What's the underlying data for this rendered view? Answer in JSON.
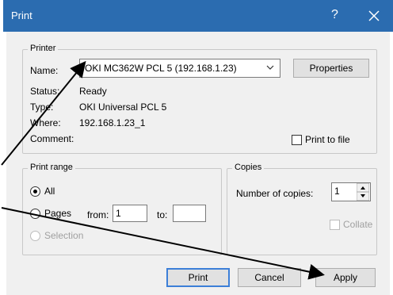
{
  "window": {
    "title": "Print",
    "help_glyph": "?",
    "close_glyph": "×"
  },
  "printer": {
    "group_label": "Printer",
    "name_label": "Name:",
    "name_value": "OKI MC362W PCL 5 (192.168.1.23)",
    "properties_label": "Properties",
    "status_label": "Status:",
    "status_value": "Ready",
    "type_label": "Type:",
    "type_value": "OKI Universal PCL 5",
    "where_label": "Where:",
    "where_value": "192.168.1.23_1",
    "comment_label": "Comment:",
    "print_to_file_label": "Print to file",
    "print_to_file_checked": false
  },
  "print_range": {
    "group_label": "Print range",
    "all_label": "All",
    "pages_label": "Pages",
    "from_label": "from:",
    "from_value": "1",
    "to_label": "to:",
    "to_value": "",
    "selection_label": "Selection",
    "selected": "All"
  },
  "copies": {
    "group_label": "Copies",
    "number_label": "Number of copies:",
    "number_value": "1",
    "collate_label": "Collate",
    "collate_checked": false
  },
  "buttons": {
    "print": "Print",
    "cancel": "Cancel",
    "apply": "Apply"
  },
  "colors": {
    "titlebar": "#2b6cb0",
    "default_button_border": "#3c7fd8",
    "dialog_bg": "#f0f0f0"
  }
}
